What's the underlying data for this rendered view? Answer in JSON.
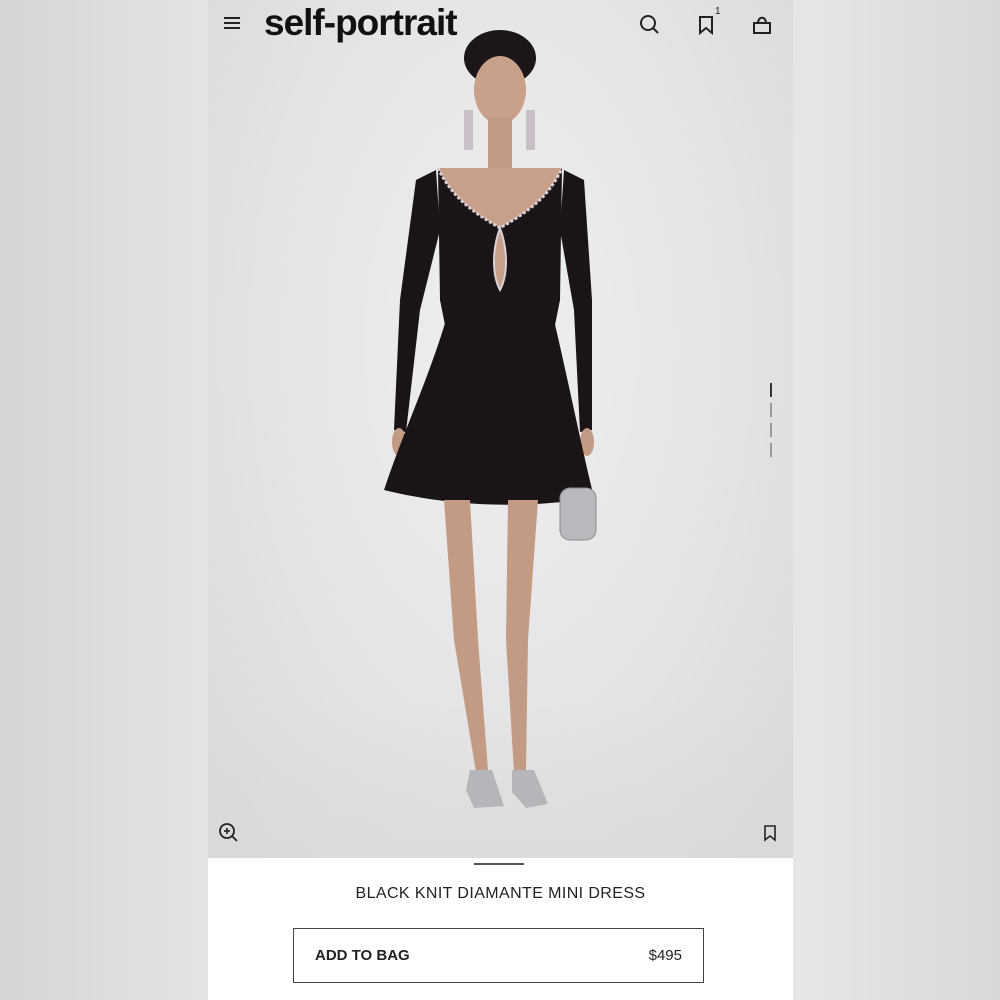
{
  "brand": {
    "logo_text": "self-portrait"
  },
  "header": {
    "wishlist_count": "1",
    "icons": [
      "menu-icon",
      "search-icon",
      "bookmark-icon",
      "bag-icon"
    ]
  },
  "gallery": {
    "total_images": 4,
    "active_index": 0
  },
  "product": {
    "name": "BLACK KNIT DIAMANTE MINI DRESS",
    "add_to_bag_label": "ADD TO BAG",
    "price": "$495"
  },
  "colors": {
    "text": "#222222",
    "dress": "#1a1416",
    "background": "#e7e6e7"
  }
}
